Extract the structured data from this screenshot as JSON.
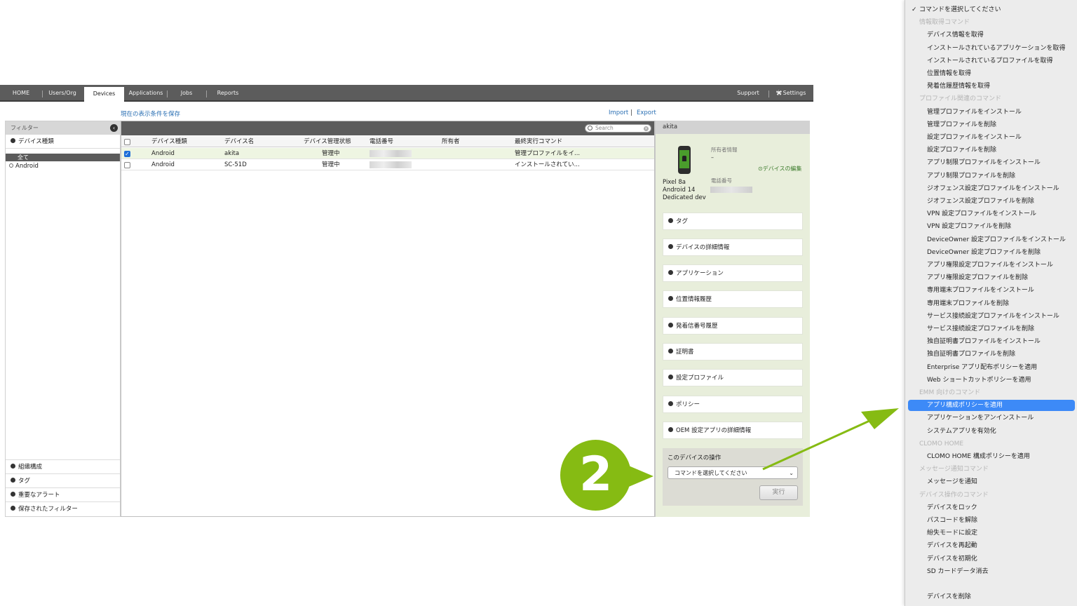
{
  "nav": {
    "tabs": [
      {
        "label": "HOME"
      },
      {
        "label": "Users/Org"
      },
      {
        "label": "Devices"
      },
      {
        "label": "Applications"
      },
      {
        "label": "Jobs"
      },
      {
        "label": "Reports"
      }
    ],
    "support": "Support",
    "settings": "Settings"
  },
  "toolbar": {
    "save_view": "現在の表示条件を保存",
    "import": "Import",
    "sep": "|",
    "export": "Export"
  },
  "filter": {
    "title": "フィルター",
    "device_type": "デバイス種類",
    "option_all": "全て",
    "option_android": "Android",
    "bottom": [
      "組織構成",
      "タグ",
      "重要なアラート",
      "保存されたフィルター"
    ]
  },
  "table": {
    "search_placeholder": "Search",
    "columns": [
      "デバイス種類",
      "デバイス名",
      "デバイス管理状態",
      "電話番号",
      "所有者",
      "最終実行コマンド"
    ],
    "rows": [
      {
        "type": "Android",
        "name": "akita",
        "state": "管理中",
        "phone": "",
        "owner": "",
        "last_cmd": "管理プロファイルをイ...",
        "checked": true
      },
      {
        "type": "Android",
        "name": "SC-51D",
        "state": "管理中",
        "phone": "",
        "owner": "",
        "last_cmd": "インストールされてい...",
        "checked": false
      }
    ]
  },
  "details": {
    "device_name": "akita",
    "model": "Pixel 8a",
    "os": "Android 14",
    "mode": "Dedicated device",
    "owner_label": "所有者情報",
    "owner_value": "–",
    "phone_label": "電話番号",
    "edit_link": "デバイスの編集",
    "sections": [
      "タグ",
      "デバイスの詳細情報",
      "アプリケーション",
      "位置情報履歴",
      "発着信番号履歴",
      "証明書",
      "設定プロファイル",
      "ポリシー",
      "OEM 設定アプリの詳細情報"
    ],
    "ops_title": "このデバイスの操作",
    "select_value": "コマンドを選択してください",
    "run_button": "実行"
  },
  "callout": {
    "number": "2",
    "color": "#86bb13"
  },
  "menu": {
    "items": [
      {
        "kind": "checked",
        "label": "コマンドを選択してください"
      },
      {
        "kind": "group",
        "label": "情報取得コマンド"
      },
      {
        "kind": "item",
        "label": "デバイス情報を取得"
      },
      {
        "kind": "item",
        "label": "インストールされているアプリケーションを取得"
      },
      {
        "kind": "item",
        "label": "インストールされているプロファイルを取得"
      },
      {
        "kind": "item",
        "label": "位置情報を取得"
      },
      {
        "kind": "item",
        "label": "発着信履歴情報を取得"
      },
      {
        "kind": "group",
        "label": "プロファイル関連のコマンド"
      },
      {
        "kind": "item",
        "label": "管理プロファイルをインストール"
      },
      {
        "kind": "item",
        "label": "管理プロファイルを削除"
      },
      {
        "kind": "item",
        "label": "設定プロファイルをインストール"
      },
      {
        "kind": "item",
        "label": "設定プロファイルを削除"
      },
      {
        "kind": "item",
        "label": "アプリ制限プロファイルをインストール"
      },
      {
        "kind": "item",
        "label": "アプリ制限プロファイルを削除"
      },
      {
        "kind": "item",
        "label": "ジオフェンス設定プロファイルをインストール"
      },
      {
        "kind": "item",
        "label": "ジオフェンス設定プロファイルを削除"
      },
      {
        "kind": "item",
        "label": "VPN 設定プロファイルをインストール"
      },
      {
        "kind": "item",
        "label": "VPN 設定プロファイルを削除"
      },
      {
        "kind": "item",
        "label": "DeviceOwner 設定プロファイルをインストール"
      },
      {
        "kind": "item",
        "label": "DeviceOwner 設定プロファイルを削除"
      },
      {
        "kind": "item",
        "label": "アプリ権限設定プロファイルをインストール"
      },
      {
        "kind": "item",
        "label": "アプリ権限設定プロファイルを削除"
      },
      {
        "kind": "item",
        "label": "専用端末プロファイルをインストール"
      },
      {
        "kind": "item",
        "label": "専用端末プロファイルを削除"
      },
      {
        "kind": "item",
        "label": "サービス接続設定プロファイルをインストール"
      },
      {
        "kind": "item",
        "label": "サービス接続設定プロファイルを削除"
      },
      {
        "kind": "item",
        "label": "独自証明書プロファイルをインストール"
      },
      {
        "kind": "item",
        "label": "独自証明書プロファイルを削除"
      },
      {
        "kind": "item",
        "label": "Enterprise アプリ配布ポリシーを適用"
      },
      {
        "kind": "item",
        "label": "Web ショートカットポリシーを適用"
      },
      {
        "kind": "group",
        "label": "EMM 向けのコマンド"
      },
      {
        "kind": "item",
        "label": "アプリ構成ポリシーを適用",
        "highlighted": true
      },
      {
        "kind": "item",
        "label": "アプリケーションをアンインストール"
      },
      {
        "kind": "item",
        "label": "システムアプリを有効化"
      },
      {
        "kind": "group",
        "label": "CLOMO HOME"
      },
      {
        "kind": "item",
        "label": "CLOMO HOME 構成ポリシーを適用"
      },
      {
        "kind": "group",
        "label": "メッセージ通知コマンド"
      },
      {
        "kind": "item",
        "label": "メッセージを通知"
      },
      {
        "kind": "group",
        "label": "デバイス操作のコマンド"
      },
      {
        "kind": "item",
        "label": "デバイスをロック"
      },
      {
        "kind": "item",
        "label": "パスコードを解除"
      },
      {
        "kind": "item",
        "label": "紛失モードに設定"
      },
      {
        "kind": "item",
        "label": "デバイスを再起動"
      },
      {
        "kind": "item",
        "label": "デバイスを初期化"
      },
      {
        "kind": "item",
        "label": "SD カードデータ消去"
      },
      {
        "kind": "spacer",
        "label": ""
      },
      {
        "kind": "item",
        "label": "デバイスを削除"
      }
    ]
  }
}
